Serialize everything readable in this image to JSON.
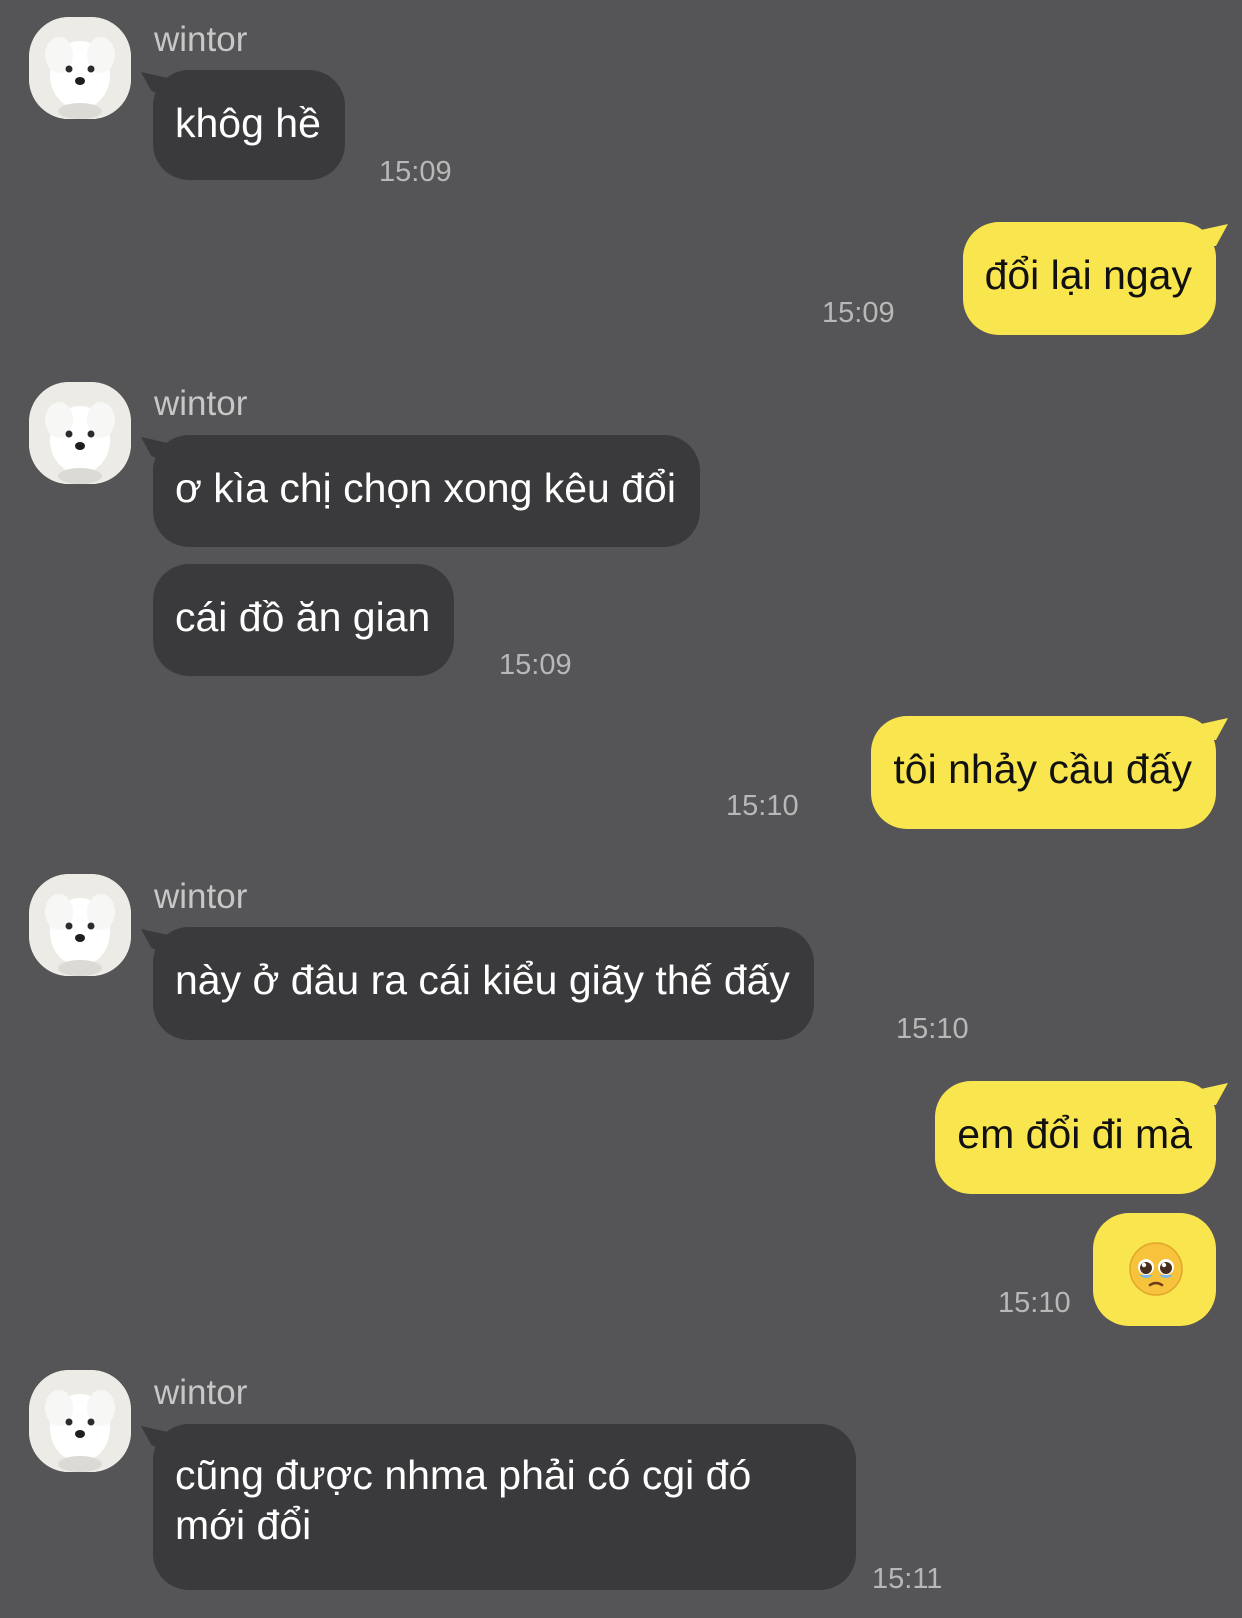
{
  "contact": {
    "name": "wintor"
  },
  "messages": [
    {
      "from": "wintor",
      "text": "khôg hề",
      "time": "15:09"
    },
    {
      "from": "me",
      "text": "đổi lại ngay",
      "time": "15:09"
    },
    {
      "from": "wintor",
      "text": "ơ kìa chị chọn xong kêu đổi"
    },
    {
      "from": "wintor",
      "text": "cái đồ ăn gian",
      "time": "15:09"
    },
    {
      "from": "me",
      "text": "tôi nhảy cầu đấy",
      "time": "15:10"
    },
    {
      "from": "wintor",
      "text": "này ở đâu ra cái kiểu giãy thế đấy",
      "time": "15:10"
    },
    {
      "from": "me",
      "text": "em đổi đi mà"
    },
    {
      "from": "me",
      "emoji": "pleading-face",
      "time": "15:10"
    },
    {
      "from": "wintor",
      "text": "cũng được nhma phải có cgi đó mới đổi",
      "time": "15:11"
    }
  ],
  "colors": {
    "background": "#555456",
    "incoming_bubble": "#3a3a3c",
    "outgoing_bubble": "#f9e54e"
  }
}
